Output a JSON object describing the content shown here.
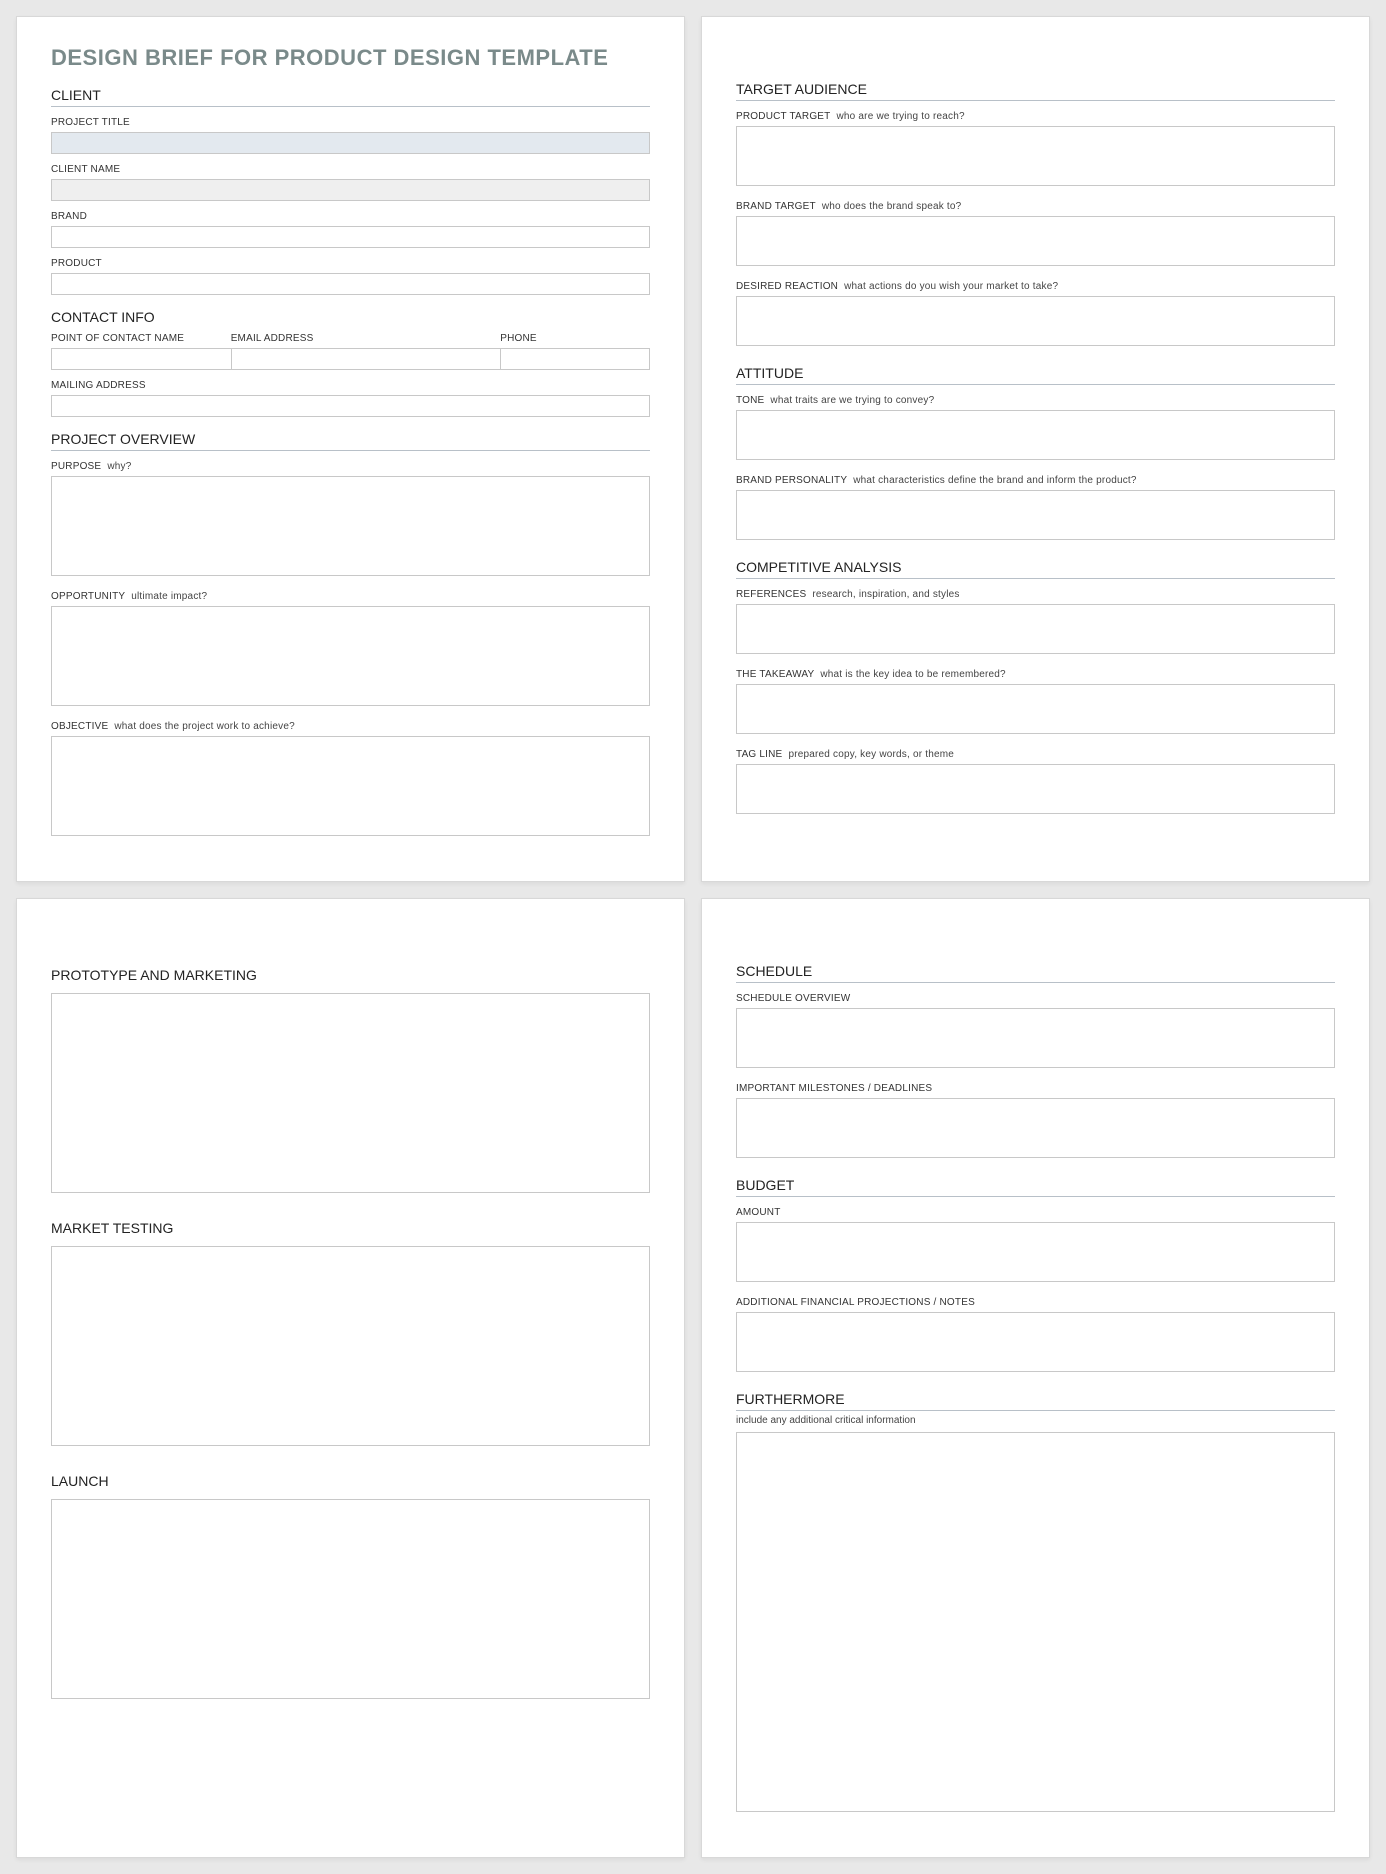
{
  "doc_title": "DESIGN BRIEF FOR PRODUCT DESIGN TEMPLATE",
  "p1": {
    "client": "CLIENT",
    "project_title": "PROJECT TITLE",
    "client_name": "CLIENT NAME",
    "brand": "BRAND",
    "product": "PRODUCT",
    "contact_info": "CONTACT INFO",
    "poc": "POINT OF CONTACT NAME",
    "email": "EMAIL ADDRESS",
    "phone": "PHONE",
    "mailing": "MAILING ADDRESS",
    "overview": "PROJECT OVERVIEW",
    "purpose": "PURPOSE",
    "purpose_hint": "why?",
    "opportunity": "OPPORTUNITY",
    "opportunity_hint": "ultimate impact?",
    "objective": "OBJECTIVE",
    "objective_hint": "what does the project work to achieve?"
  },
  "p2": {
    "target_audience": "TARGET AUDIENCE",
    "product_target": "PRODUCT TARGET",
    "product_target_hint": "who are we trying to reach?",
    "brand_target": "BRAND TARGET",
    "brand_target_hint": "who does the brand speak to?",
    "desired_reaction": "DESIRED REACTION",
    "desired_reaction_hint": "what actions do you wish your market to take?",
    "attitude": "ATTITUDE",
    "tone": "TONE",
    "tone_hint": "what traits are we trying to convey?",
    "brand_personality": "BRAND PERSONALITY",
    "brand_personality_hint": "what characteristics define the brand and inform the product?",
    "competitive": "COMPETITIVE ANALYSIS",
    "references": "REFERENCES",
    "references_hint": "research, inspiration, and styles",
    "takeaway": "THE TAKEAWAY",
    "takeaway_hint": "what is the key idea to be remembered?",
    "tagline": "TAG LINE",
    "tagline_hint": "prepared copy, key words, or theme"
  },
  "p3": {
    "proto": "PROTOTYPE AND MARKETING",
    "market_testing": "MARKET TESTING",
    "launch": "LAUNCH"
  },
  "p4": {
    "schedule": "SCHEDULE",
    "schedule_overview": "SCHEDULE OVERVIEW",
    "milestones": "IMPORTANT MILESTONES / DEADLINES",
    "budget": "BUDGET",
    "amount": "AMOUNT",
    "fin_notes": "ADDITIONAL FINANCIAL PROJECTIONS / NOTES",
    "furthermore": "FURTHERMORE",
    "furthermore_hint": "include any additional critical information"
  }
}
